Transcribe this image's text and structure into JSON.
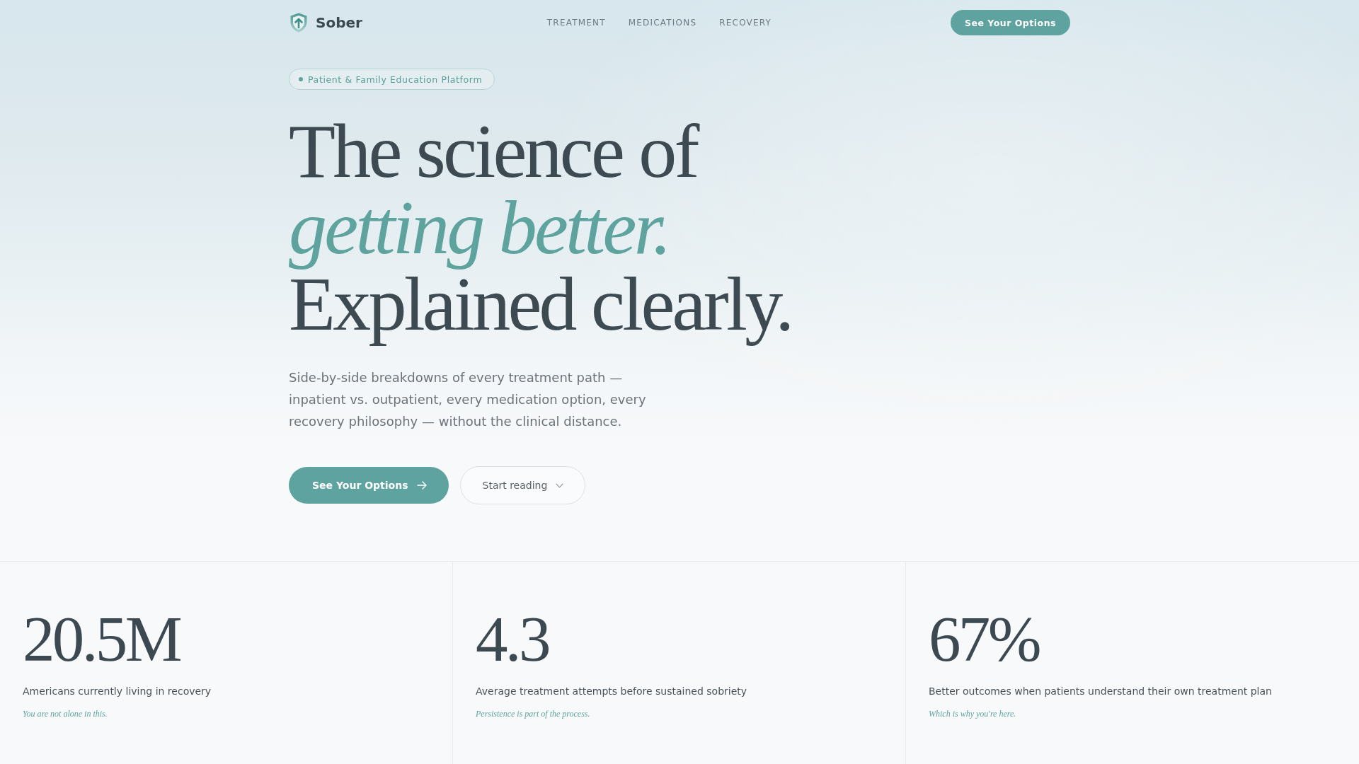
{
  "header": {
    "brand": "Sober",
    "nav": [
      "TREATMENT",
      "MEDICATIONS",
      "RECOVERY"
    ],
    "cta": "See Your Options"
  },
  "hero": {
    "badge": "Patient & Family Education Platform",
    "headline": [
      {
        "text": "The science of",
        "kind": "plain"
      },
      {
        "text": "getting better.",
        "kind": "accent"
      },
      {
        "text": "Explained clearly.",
        "kind": "plain"
      }
    ],
    "lead": "Side-by-side breakdowns of every treatment path — inpatient vs. outpatient, every medication option, every recovery philosophy — without the clinical distance.",
    "buttons": [
      {
        "label": "See Your Options",
        "kind": "primary"
      },
      {
        "label": "Start reading",
        "kind": "secondary"
      }
    ]
  },
  "stats": [
    {
      "value": "20.5M",
      "label": "Americans currently living in recovery",
      "note": "You are not alone in this."
    },
    {
      "value": "4.3",
      "label": "Average treatment attempts before sustained sobriety",
      "note": "Persistence is part of the process."
    },
    {
      "value": "67%",
      "label": "Better outcomes when patients understand their own treatment plan",
      "note": "Which is why you're here."
    }
  ]
}
